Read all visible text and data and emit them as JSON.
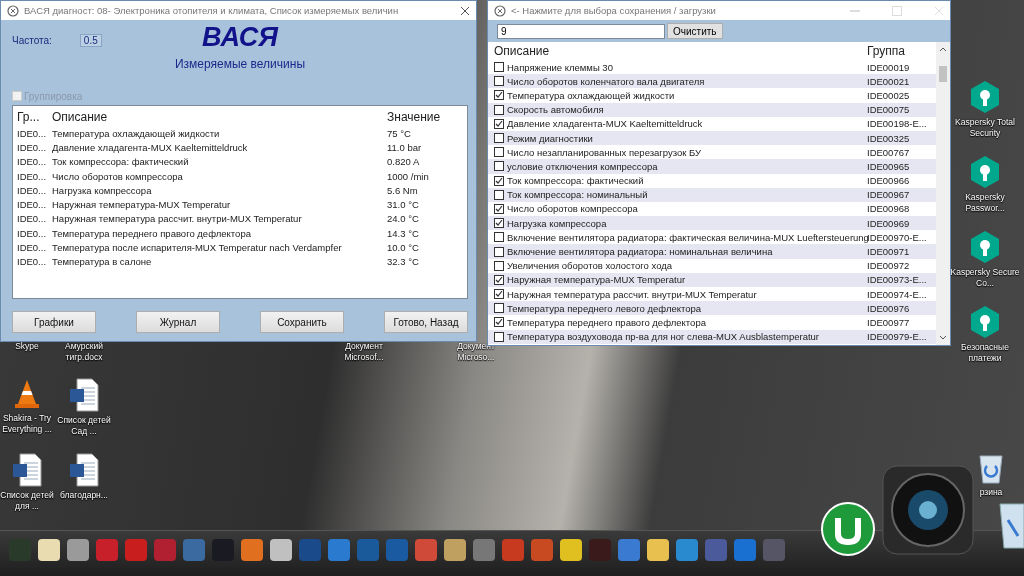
{
  "measure_window": {
    "title": "ВАСЯ диагност: 08- Электроника отопителя и климата,  Список измеряемых величин",
    "frequency_label": "Частота:",
    "frequency_value": "0.5",
    "logo": "ВАСЯ",
    "subtitle": "Измеряемые величины",
    "grouping": {
      "label": "Группировка",
      "checked": false,
      "disabled": true
    },
    "table": {
      "columns": [
        "Гр...",
        "Описание",
        "Значение"
      ],
      "rows": [
        {
          "group": "IDE0...",
          "description": "Температура охлаждающей жидкости",
          "value": "75 °C"
        },
        {
          "group": "IDE0...",
          "description": "Давление хладагента-MUX Kaeltemitteldruck",
          "value": "11.0 bar"
        },
        {
          "group": "IDE0...",
          "description": "Ток компрессора: фактический",
          "value": "0.820 A"
        },
        {
          "group": "IDE0...",
          "description": "Число оборотов компрессора",
          "value": "1000 /min"
        },
        {
          "group": "IDE0...",
          "description": "Нагрузка компрессора",
          "value": "5.6 Nm"
        },
        {
          "group": "IDE0...",
          "description": "Наружная температура-MUX Temperatur",
          "value": "31.0 °C"
        },
        {
          "group": "IDE0...",
          "description": "Наружная температура рассчит. внутри-MUX Temperatur",
          "value": "24.0 °C"
        },
        {
          "group": "IDE0...",
          "description": "Температура переднего правого дефлектора",
          "value": "14.3 °C"
        },
        {
          "group": "IDE0...",
          "description": "Температура после испарителя-MUX Temperatur nach Verdampfer",
          "value": "10.0 °C"
        },
        {
          "group": "IDE0...",
          "description": "Температура в салоне",
          "value": "32.3 °C"
        }
      ]
    },
    "buttons": [
      "Графики",
      "Журнал",
      "Сохранить",
      "Готово, Назад"
    ]
  },
  "selection_window": {
    "title": "<- Нажмите для выбора сохранения / загрузки",
    "search": {
      "value": "9"
    },
    "clear_button": "Очистить",
    "columns": [
      "Описание",
      "Группа"
    ],
    "rows": [
      {
        "description": "Напряжение клеммы 30",
        "group": "IDE00019",
        "checked": false
      },
      {
        "description": "Число оборотов коленчатого вала двигателя",
        "group": "IDE00021",
        "checked": false
      },
      {
        "description": "Температура охлаждающей жидкости",
        "group": "IDE00025",
        "checked": true
      },
      {
        "description": "Скорость автомобиля",
        "group": "IDE00075",
        "checked": false
      },
      {
        "description": "Давление хладагента-MUX Kaeltemitteldruck",
        "group": "IDE00198-E...",
        "checked": true
      },
      {
        "description": "Режим диагностики",
        "group": "IDE00325",
        "checked": false
      },
      {
        "description": "Число незапланированных перезагрузок БУ",
        "group": "IDE00767",
        "checked": false
      },
      {
        "description": "условие отключения компрессора",
        "group": "IDE00965",
        "checked": false
      },
      {
        "description": "Ток компрессора: фактический",
        "group": "IDE00966",
        "checked": true
      },
      {
        "description": "Ток компрессора: номинальный",
        "group": "IDE00967",
        "checked": false
      },
      {
        "description": "Число оборотов компрессора",
        "group": "IDE00968",
        "checked": true
      },
      {
        "description": "Нагрузка компрессора",
        "group": "IDE00969",
        "checked": true
      },
      {
        "description": "Включение вентилятора радиатора: фактическая величина-MUX Lueftersteuerung",
        "group": "IDE00970-E...",
        "checked": false
      },
      {
        "description": "Включение вентилятора радиатора: номинальная величина",
        "group": "IDE00971",
        "checked": false
      },
      {
        "description": "Увеличения оборотов холостого хода",
        "group": "IDE00972",
        "checked": false
      },
      {
        "description": "Наружная температура-MUX Temperatur",
        "group": "IDE00973-E...",
        "checked": true
      },
      {
        "description": "Наружная температура рассчит. внутри-MUX Temperatur",
        "group": "IDE00974-E...",
        "checked": true
      },
      {
        "description": "Температура переднего левого дефлектора",
        "group": "IDE00976",
        "checked": false
      },
      {
        "description": "Температура переднего правого дефлектора",
        "group": "IDE00977",
        "checked": true
      },
      {
        "description": "Температура воздуховода пр-ва для ног слева-MUX Ausblastemperatur",
        "group": "IDE00979-E...",
        "checked": false
      }
    ]
  },
  "desktop_icons": [
    {
      "label": "Skype",
      "kind": "covered"
    },
    {
      "label": "Амурский тигр.docx",
      "kind": "covered"
    },
    {
      "label": "Документ Microsof...",
      "kind": "covered"
    },
    {
      "label": "Документ Microso...",
      "kind": "covered"
    },
    {
      "label": "Shakira - Try Everything ...",
      "kind": "media"
    },
    {
      "label": "Список детей Сад ...",
      "kind": "document"
    },
    {
      "label": "Список детей для ...",
      "kind": "document"
    },
    {
      "label": "благодарн...",
      "kind": "document"
    },
    {
      "label": "Kaspersky Total Security",
      "kind": "security"
    },
    {
      "label": "Kaspersky Passwor...",
      "kind": "security"
    },
    {
      "label": "Kaspersky Secure Co...",
      "kind": "security"
    },
    {
      "label": "Безопасные платежи",
      "kind": "security"
    },
    {
      "label": "рзина",
      "kind": "bin"
    }
  ]
}
